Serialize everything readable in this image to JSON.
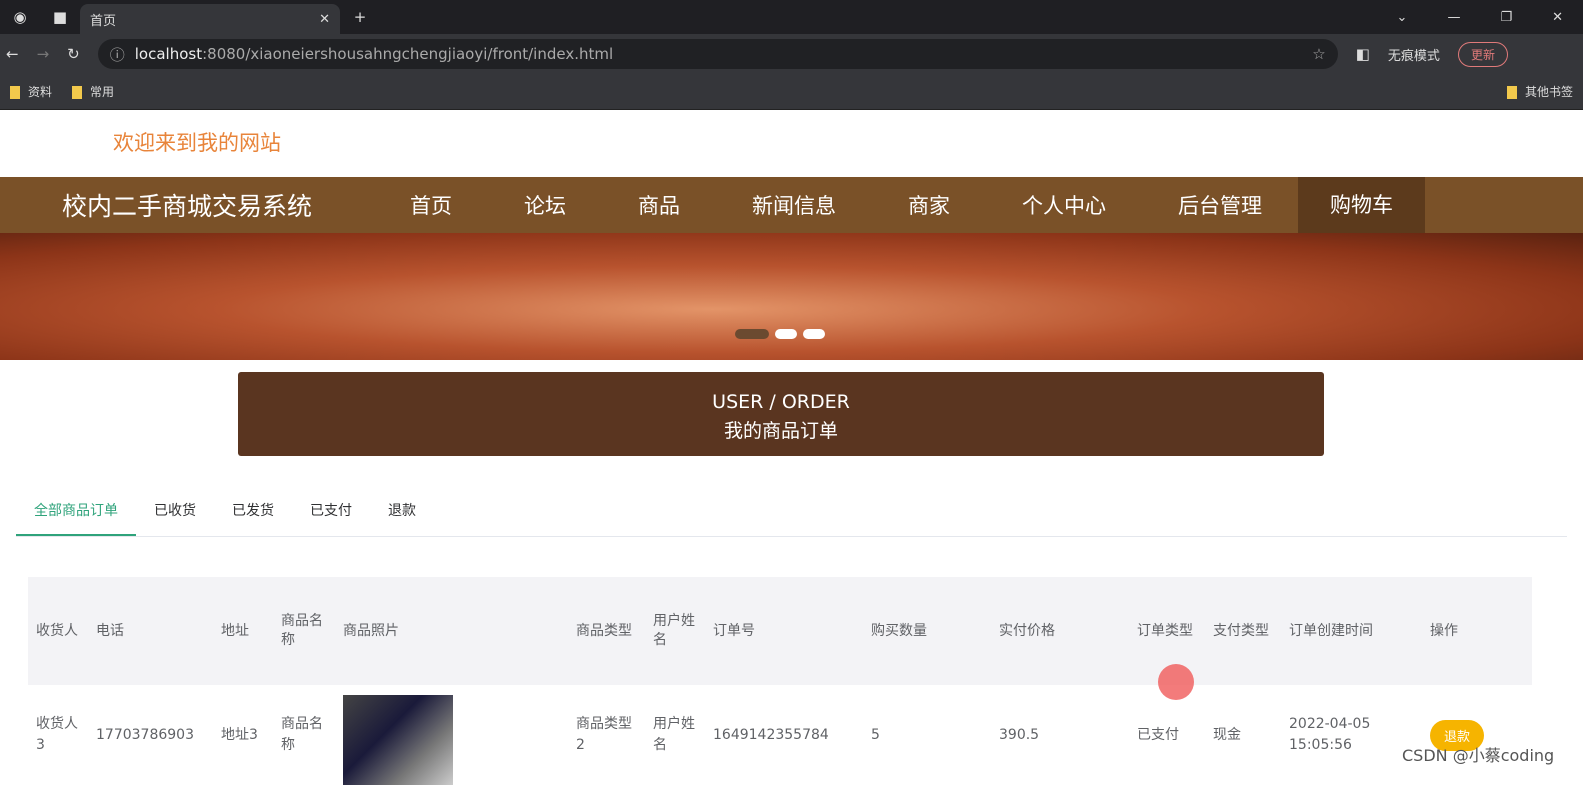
{
  "browser": {
    "tab_title": "首页",
    "url_host": "localhost",
    "url_rest": ":8080/xiaoneiershousahngchengjiaoyi/front/index.html",
    "incognito": "无痕模式",
    "update": "更新",
    "bookmarks": [
      "资料",
      "常用"
    ],
    "other_bookmarks": "其他书签"
  },
  "site": {
    "welcome": "欢迎来到我的网站",
    "brand": "校内二手商城交易系统",
    "nav": [
      "首页",
      "论坛",
      "商品",
      "新闻信息",
      "商家",
      "个人中心",
      "后台管理"
    ],
    "cart": "购物车"
  },
  "section": {
    "en": "USER / ORDER",
    "zh": "我的商品订单"
  },
  "tabs": [
    "全部商品订单",
    "已收货",
    "已发货",
    "已支付",
    "退款"
  ],
  "table": {
    "headers": [
      "收货人",
      "电话",
      "地址",
      "商品名称",
      "商品照片",
      "商品类型",
      "用户姓名",
      "订单号",
      "购买数量",
      "实付价格",
      "订单类型",
      "支付类型",
      "订单创建时间",
      "操作"
    ],
    "rows": [
      {
        "receiver": "收货人3",
        "phone": "17703786903",
        "address": "地址3",
        "name": "商品名称",
        "type": "商品类型2",
        "user": "用户姓名",
        "order_no": "1649142355784",
        "qty": "5",
        "price": "390.5",
        "order_type": "已支付",
        "pay_type": "现金",
        "created": "2022-04-05 15:05:56",
        "action": "退款"
      }
    ]
  },
  "watermark": "CSDN @小蔡coding"
}
